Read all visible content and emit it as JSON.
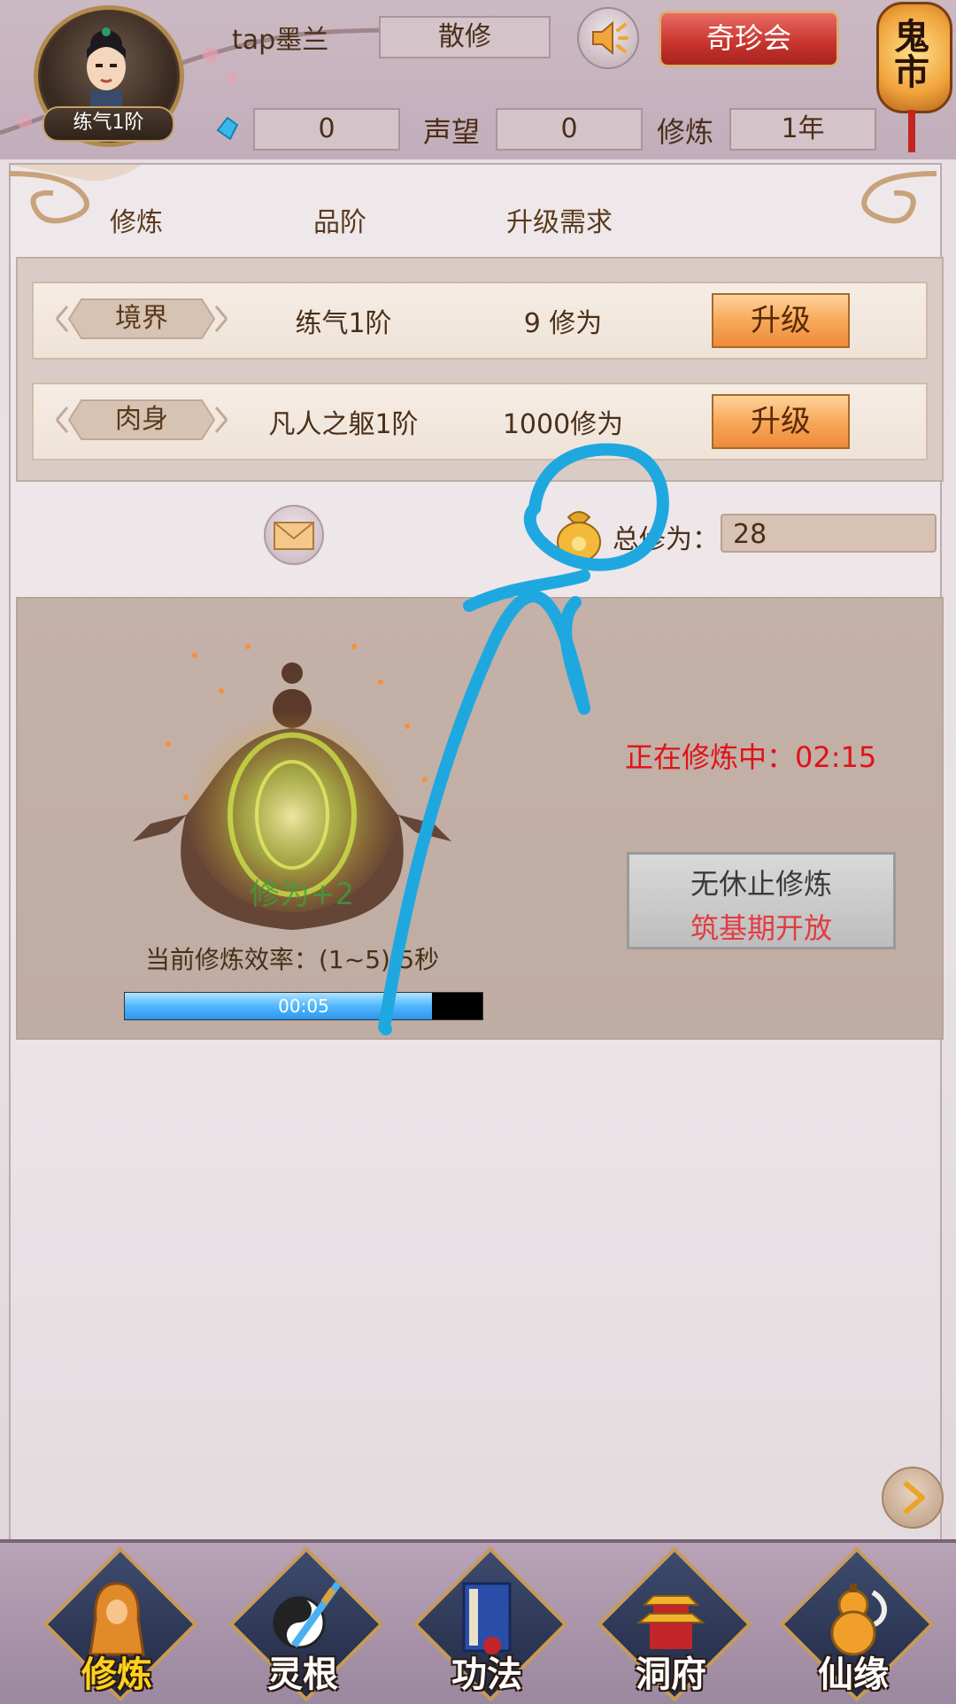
{
  "header": {
    "player_name": "tap墨兰",
    "level_badge": "练气1阶",
    "sect": "散修",
    "treasure_button": "奇珍会",
    "ghost_market": "鬼市",
    "gems": "0",
    "reputation_label": "声望",
    "reputation": "0",
    "cultivation_label": "修炼",
    "cultivation_years": "1年"
  },
  "columns": {
    "col1": "修炼",
    "col2": "品阶",
    "col3": "升级需求"
  },
  "rows": [
    {
      "tag": "境界",
      "grade": "练气1阶",
      "requirement": "9 修为",
      "button": "升级"
    },
    {
      "tag": "肉身",
      "grade": "凡人之躯1阶",
      "requirement": "1000修为",
      "button": "升级"
    }
  ],
  "total": {
    "label": "总修为：",
    "value": "28"
  },
  "cultivation": {
    "gain": "修为+2",
    "status": "正在修炼中：02:15",
    "endless_line1": "无休止修炼",
    "endless_line2": "筑基期开放",
    "efficiency": "当前修炼效率：(1~5)/5秒",
    "progress_time": "00:05",
    "progress_fraction": 0.86
  },
  "nav": [
    {
      "label": "修炼",
      "icon": "hooded-cultivator-icon",
      "active": true
    },
    {
      "label": "灵根",
      "icon": "yin-yang-sword-icon",
      "active": false
    },
    {
      "label": "功法",
      "icon": "scripture-book-icon",
      "active": false
    },
    {
      "label": "洞府",
      "icon": "pagoda-icon",
      "active": false
    },
    {
      "label": "仙缘",
      "icon": "gourd-icon",
      "active": false
    }
  ],
  "colors": {
    "accent_red": "#e0121a",
    "upgrade_orange": "#f7a95a",
    "annotation_blue": "#1fa8e0",
    "nav_active": "#ffd21e"
  }
}
